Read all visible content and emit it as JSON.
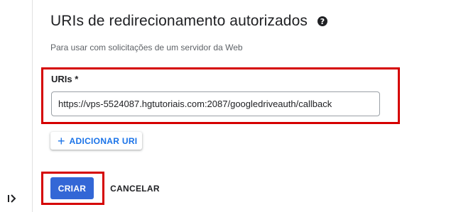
{
  "section": {
    "title": "URIs de redirecionamento autorizados",
    "help_icon": "help-circle-icon",
    "subtitle": "Para usar com solicitações de um servidor da Web"
  },
  "uris_field": {
    "label": "URIs *",
    "value": "https://vps-5524087.hgtutoriais.com:2087/googledriveauth/callback"
  },
  "add_uri_button": {
    "icon": "plus-icon",
    "label": "ADICIONAR URI"
  },
  "actions": {
    "create_label": "CRIAR",
    "cancel_label": "CANCELAR"
  },
  "rail": {
    "expand_icon": "expand-panel-icon"
  },
  "colors": {
    "highlight_border": "#d50000",
    "primary_button": "#3367d6",
    "link_blue": "#1a73e8"
  }
}
